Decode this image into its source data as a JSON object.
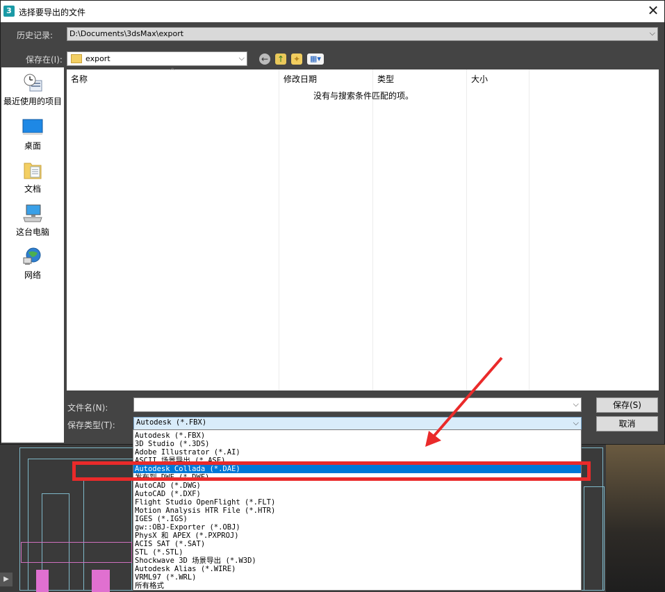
{
  "window": {
    "title": "选择要导出的文件",
    "close_glyph": "✕"
  },
  "history": {
    "label": "历史记录:",
    "path": "D:\\Documents\\3dsMax\\export"
  },
  "save_in": {
    "label": "保存在(I):",
    "folder": "export"
  },
  "places": [
    {
      "label": "最近使用的项目",
      "icon": "recent-items-icon"
    },
    {
      "label": "桌面",
      "icon": "desktop-icon"
    },
    {
      "label": "文档",
      "icon": "documents-icon"
    },
    {
      "label": "这台电脑",
      "icon": "this-pc-icon"
    },
    {
      "label": "网络",
      "icon": "network-icon"
    }
  ],
  "file_list": {
    "columns": [
      "名称",
      "修改日期",
      "类型",
      "大小"
    ],
    "empty_message": "没有与搜索条件匹配的项。"
  },
  "file_name": {
    "label": "文件名(N):",
    "value": ""
  },
  "file_type": {
    "label": "保存类型(T):",
    "value": "Autodesk (*.FBX)",
    "options": [
      "Autodesk (*.FBX)",
      "3D Studio (*.3DS)",
      "Adobe Illustrator (*.AI)",
      "ASCII 场景导出 (*.ASE)",
      "Autodesk Collada (*.DAE)",
      "发布到 DWF (*.DWF)",
      "AutoCAD (*.DWG)",
      "AutoCAD (*.DXF)",
      "Flight Studio OpenFlight (*.FLT)",
      "Motion Analysis HTR File (*.HTR)",
      "IGES (*.IGS)",
      "gw::OBJ-Exporter (*.OBJ)",
      "PhysX 和 APEX (*.PXPROJ)",
      "ACIS SAT (*.SAT)",
      "STL (*.STL)",
      "Shockwave 3D 场景导出 (*.W3D)",
      "Autodesk Alias (*.WIRE)",
      "VRML97 (*.WRL)",
      "所有格式"
    ],
    "selected_index": 4
  },
  "buttons": {
    "save": "保存(S)",
    "cancel": "取消"
  },
  "annotation": {
    "color": "#ea2a2a"
  }
}
